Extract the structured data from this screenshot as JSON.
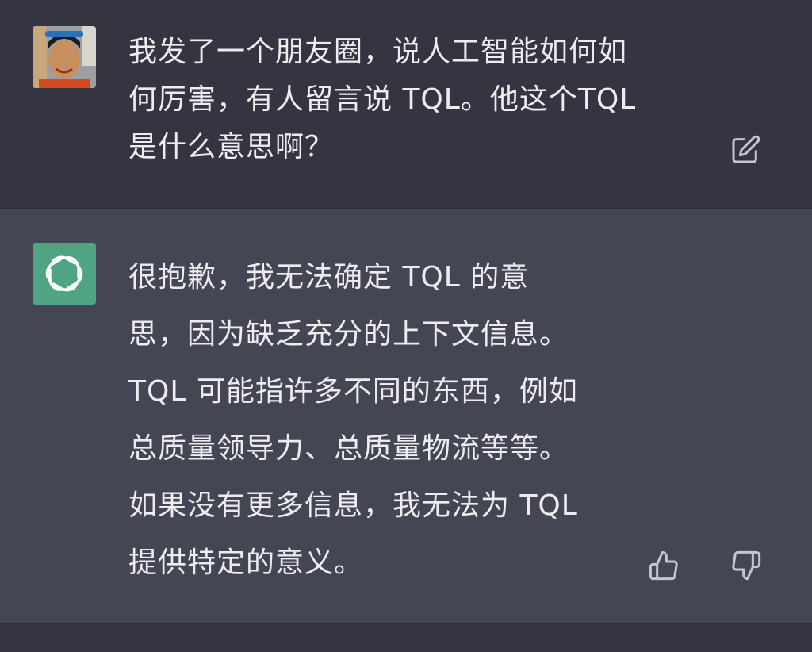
{
  "conversation": {
    "user_message": "我发了一个朋友圈，说人工智能如何如\n何厉害，有人留言说 TQL。他这个TQL\n是什么意思啊？",
    "assistant_message": "很抱歉，我无法确定 TQL 的意\n思，因为缺乏充分的上下文信息。\nTQL 可能指许多不同的东西，例如\n总质量领导力、总质量物流等等。\n如果没有更多信息，我无法为 TQL\n提供特定的意义。"
  },
  "icons": {
    "user_avatar": "user-avatar-photo",
    "bot_avatar": "openai-logo-icon",
    "edit": "edit-icon",
    "thumbs_up": "thumbs-up-icon",
    "thumbs_down": "thumbs-down-icon"
  },
  "colors": {
    "background": "#343541",
    "assistant_background": "#444654",
    "bot_avatar": "#4fa583",
    "text": "#ececf1",
    "icon": "#c5c5d2"
  }
}
